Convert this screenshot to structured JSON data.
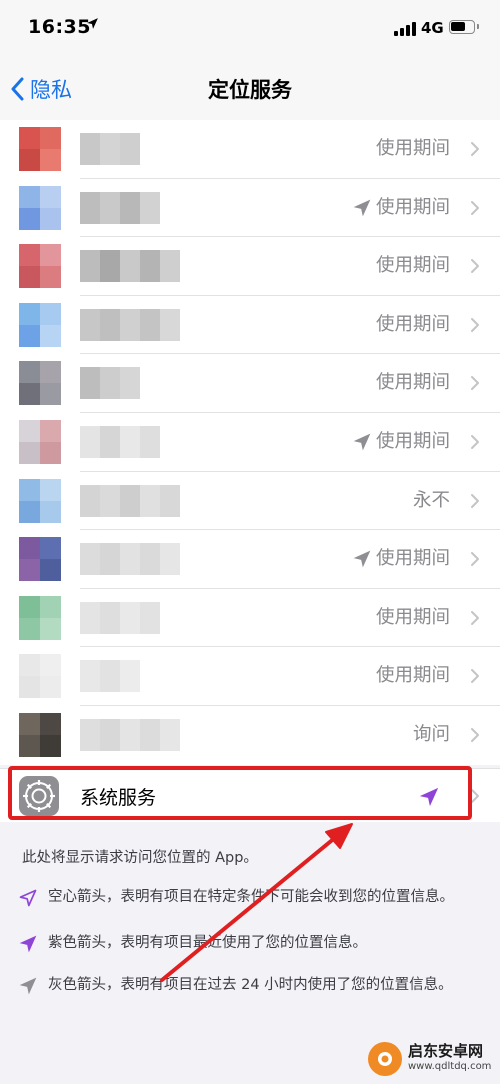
{
  "status_bar": {
    "time": "16:35",
    "network": "4G"
  },
  "nav": {
    "back_label": "隐私",
    "title": "定位服务"
  },
  "apps": [
    {
      "permission": "使用期间",
      "arrow": "none",
      "icon_colors": [
        "#d9534f",
        "#e06a60",
        "#c94a44",
        "#e87a70"
      ],
      "name_colors": [
        "#c8c8c8",
        "#d4d4d4",
        "#cfcfcf"
      ]
    },
    {
      "permission": "使用期间",
      "arrow": "gray",
      "icon_colors": [
        "#8fb4e8",
        "#b8cff2",
        "#6f98e0",
        "#a9c3ee"
      ],
      "name_colors": [
        "#bdbdbd",
        "#c9c9c9",
        "#b8b8b8",
        "#d2d2d2"
      ]
    },
    {
      "permission": "使用期间",
      "arrow": "none",
      "icon_colors": [
        "#d6666b",
        "#e2959a",
        "#c9585e",
        "#da7c80"
      ],
      "name_colors": [
        "#bcbcbc",
        "#a8a8a8",
        "#c9c9c9",
        "#b4b4b4",
        "#cfcfcf"
      ]
    },
    {
      "permission": "使用期间",
      "arrow": "none",
      "icon_colors": [
        "#7fb6ea",
        "#a7cbf0",
        "#6ea2e6",
        "#b8d4f4"
      ],
      "name_colors": [
        "#c7c7c7",
        "#bfbfbf",
        "#d0d0d0",
        "#c4c4c4",
        "#d8d8d8"
      ]
    },
    {
      "permission": "使用期间",
      "arrow": "none",
      "icon_colors": [
        "#8a8d96",
        "#a6a3ab",
        "#6f707a",
        "#9a9aa2"
      ],
      "name_colors": [
        "#bdbdbd",
        "#cdcdcd",
        "#d6d6d6"
      ]
    },
    {
      "permission": "使用期间",
      "arrow": "gray",
      "icon_colors": [
        "#d7d3d8",
        "#d9a9ad",
        "#c8c0c6",
        "#cf9a9f"
      ],
      "name_colors": [
        "#e4e4e4",
        "#d6d6d6",
        "#e8e8e8",
        "#dedede"
      ]
    },
    {
      "permission": "永不",
      "arrow": "none",
      "icon_colors": [
        "#8fbbe6",
        "#b9d5ef",
        "#79a8df",
        "#a6c9ec"
      ],
      "name_colors": [
        "#d4d4d4",
        "#dadada",
        "#cecece",
        "#e0e0e0",
        "#d8d8d8"
      ]
    },
    {
      "permission": "使用期间",
      "arrow": "gray",
      "icon_colors": [
        "#7d5aa0",
        "#5d6fb0",
        "#8b64a8",
        "#4f5f9e"
      ],
      "name_colors": [
        "#dcdcdc",
        "#d6d6d6",
        "#e2e2e2",
        "#dadada",
        "#e6e6e6"
      ]
    },
    {
      "permission": "使用期间",
      "arrow": "none",
      "icon_colors": [
        "#7fbf98",
        "#a2d2b4",
        "#8dc7a3",
        "#b3dbc2"
      ],
      "name_colors": [
        "#e4e4e4",
        "#dedede",
        "#e9e9e9",
        "#e2e2e2"
      ]
    },
    {
      "permission": "使用期间",
      "arrow": "none",
      "icon_colors": [
        "#e8e8e8",
        "#efefef",
        "#e4e4e4",
        "#ececec"
      ],
      "name_colors": [
        "#e8e8e8",
        "#e2e2e2",
        "#ececec"
      ]
    },
    {
      "permission": "询问",
      "arrow": "none",
      "icon_colors": [
        "#6f675e",
        "#4d4843",
        "#5e5750",
        "#3f3b37"
      ],
      "name_colors": [
        "#dedede",
        "#d8d8d8",
        "#e4e4e4",
        "#dcdcdc",
        "#e6e6e6"
      ]
    }
  ],
  "system_services": {
    "label": "系统服务",
    "arrow": "purple"
  },
  "footer": {
    "note": "此处将显示请求访问您位置的 App。",
    "legend": [
      {
        "icon": "hollow-arrow-icon",
        "text": "空心箭头，表明有项目在特定条件下可能会收到您的位置信息。"
      },
      {
        "icon": "purple-arrow-icon",
        "text": "紫色箭头，表明有项目最近使用了您的位置信息。"
      },
      {
        "icon": "gray-arrow-icon",
        "text": "灰色箭头，表明有项目在过去 24 小时内使用了您的位置信息。"
      }
    ]
  },
  "watermark": {
    "name": "启东安卓网",
    "url": "www.qdltdq.com"
  },
  "colors": {
    "accent": "#1a73e8",
    "purple_arrow": "#8e44d6",
    "gray_arrow": "#8e8e93",
    "annotation_red": "#e02020"
  }
}
